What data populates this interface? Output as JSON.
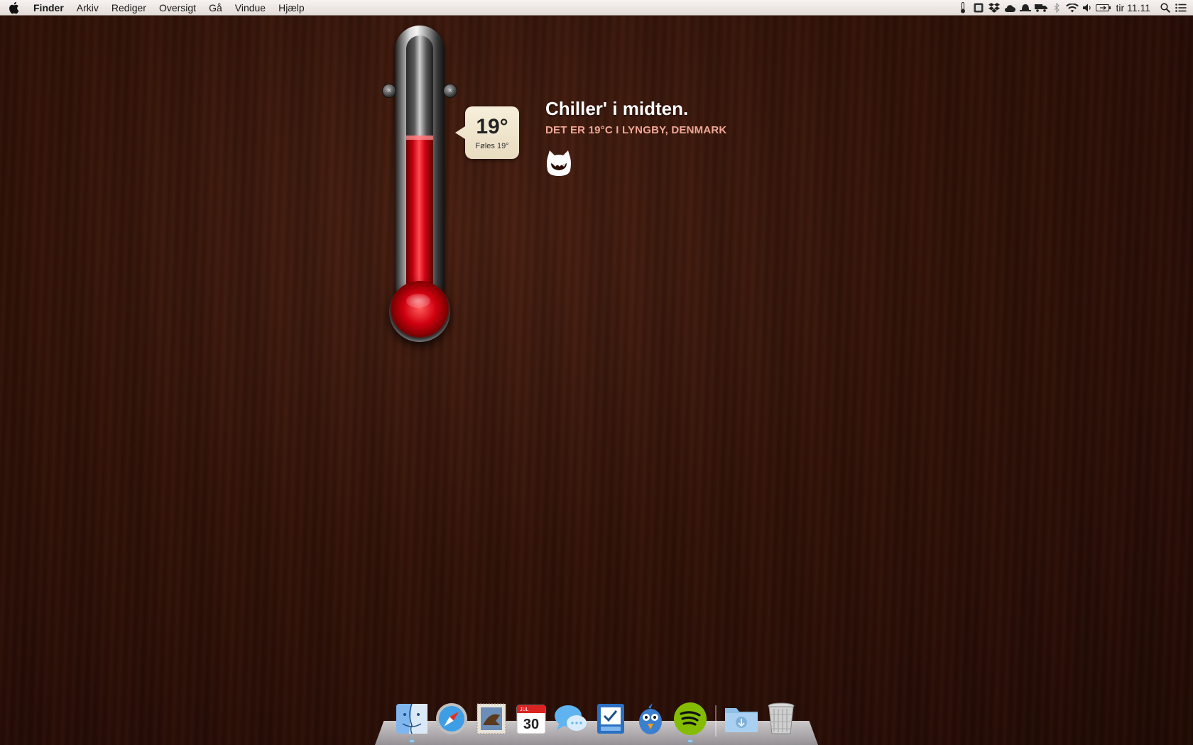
{
  "menubar": {
    "app_name": "Finder",
    "items": [
      "Arkiv",
      "Rediger",
      "Oversigt",
      "Gå",
      "Vindue",
      "Hjælp"
    ],
    "clock": "tir 11.11"
  },
  "weather": {
    "temperature": "19°",
    "feels_like": "Føles 19°",
    "headline": "Chiller' i midten.",
    "subline": "DET ER 19°C I LYNGBY, DENMARK",
    "mercury_level": 0.63
  },
  "dock": {
    "calendar": {
      "month": "JUL",
      "day": "30"
    }
  }
}
